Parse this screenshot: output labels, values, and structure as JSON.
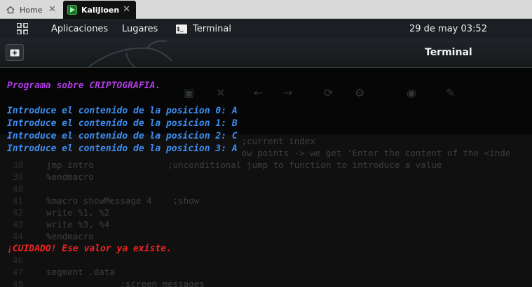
{
  "host_tabs": [
    {
      "label": "Home"
    },
    {
      "label": "KaliJloen"
    }
  ],
  "panel": {
    "apps": "Aplicaciones",
    "places": "Lugares",
    "terminal": "Terminal",
    "clock": "29 de may  03:52"
  },
  "window": {
    "title": "Terminal"
  },
  "terminal": {
    "title_line": "Programa sobre CRIPTOGRAFIA.",
    "prompts": [
      "Introduce el contenido de la posicion 0: A",
      "Introduce el contenido de la posicion 1: B",
      "Introduce el contenido de la posicion 2: C",
      "Introduce el contenido de la posicion 3: A"
    ],
    "error": "¡CUIDADO! Ese valor ya existe."
  },
  "background_editor": {
    "lines": [
      {
        "num": "",
        "code": "                                     ;current index"
      },
      {
        "num": "",
        "code": "                                     ow points -> we get 'Enter the content of the <inde"
      },
      {
        "num": "38",
        "code": "jmp intro              ;unconditional jump to function to introduce a value"
      },
      {
        "num": "39",
        "code": "%endmacro"
      },
      {
        "num": "40",
        "code": ""
      },
      {
        "num": "41",
        "code": "%macro showMessage 4    ;show"
      },
      {
        "num": "42",
        "code": "write %1, %2"
      },
      {
        "num": "43",
        "code": "write %3, %4"
      },
      {
        "num": "44",
        "code": "%endmacro"
      },
      {
        "num": "46",
        "code": ""
      },
      {
        "num": "47",
        "code": "segment .data"
      },
      {
        "num": "48",
        "code": "              ;screen messages"
      }
    ]
  },
  "colors": {
    "title": "#b03ee6",
    "prompt": "#3d8ef2",
    "error": "#ee2424",
    "panel_bg": "#1b1e22"
  }
}
